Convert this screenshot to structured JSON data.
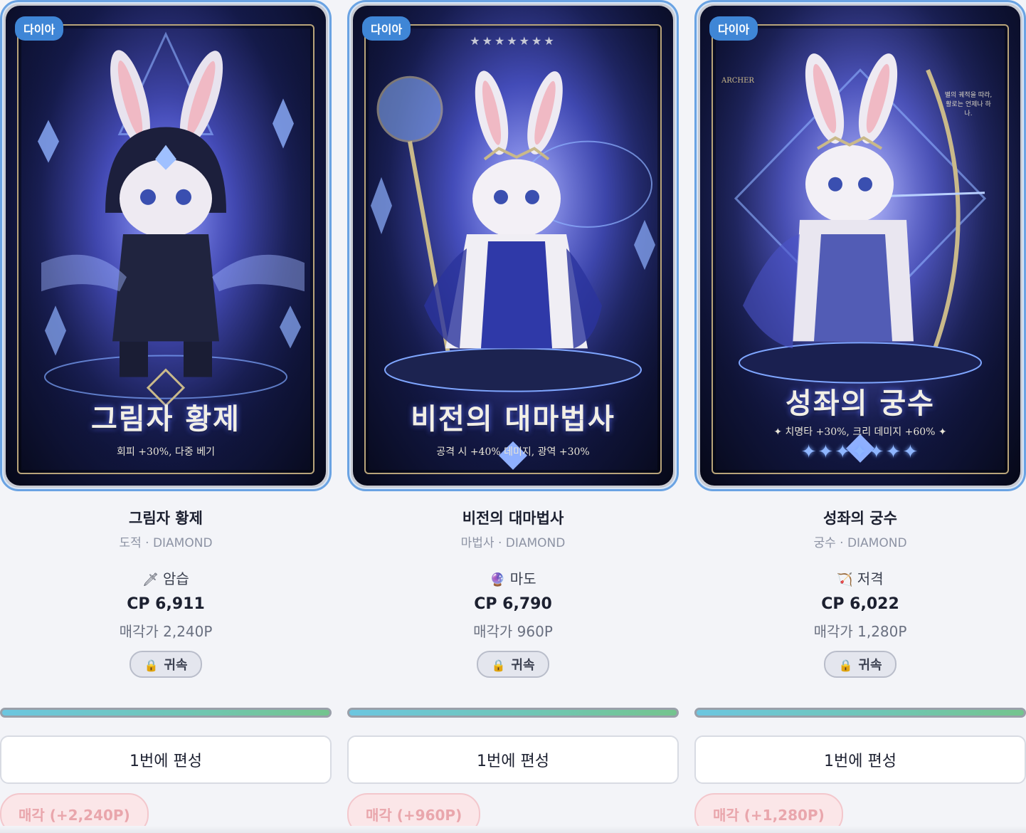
{
  "cards": [
    {
      "tier_badge": "다이아",
      "art_title": "그림자 황제",
      "art_subtitle": "회피 +30%, 다중 베기",
      "name": "그림자 황제",
      "class_line": "도적 · DIAMOND",
      "skill_icon": "dagger-icon",
      "skill_glyph": "🗡",
      "skill": "암습",
      "cp": "CP 6,911",
      "sell_price": "매각가 2,240P",
      "bound_label": "귀속",
      "assign_label": "1번에 편성",
      "sell_label": "매각 (+2,240P)"
    },
    {
      "tier_badge": "다이아",
      "art_title": "비전의 대마법사",
      "art_subtitle": "공격 시 +40% 데미지, 광역 +30%",
      "art_top_stars": "★★★★★★★",
      "name": "비전의 대마법사",
      "class_line": "마법사 · DIAMOND",
      "skill_icon": "crystal-ball-icon",
      "skill_glyph": "🔮",
      "skill": "마도",
      "cp": "CP 6,790",
      "sell_price": "매각가 960P",
      "bound_label": "귀속",
      "assign_label": "1번에 편성",
      "sell_label": "매각 (+960P)"
    },
    {
      "tier_badge": "다이아",
      "art_title": "성좌의 궁수",
      "art_subtitle": "✦ 치명타 +30%, 크리 데미지 +60% ✦",
      "art_stars": "✦✦✦✦✦✦✦",
      "art_mark": "ARCHER",
      "art_quote": "별의 궤적을 따라, 활로는 언제나 하나.",
      "name": "성좌의 궁수",
      "class_line": "궁수 · DIAMOND",
      "skill_icon": "bow-arrow-icon",
      "skill_glyph": "🏹",
      "skill": "저격",
      "cp": "CP 6,022",
      "sell_price": "매각가 1,280P",
      "bound_label": "귀속",
      "assign_label": "1번에 편성",
      "sell_label": "매각 (+1,280P)"
    }
  ],
  "lock_icon": "lock-icon",
  "colors": {
    "badge": "#3f86d6",
    "card_border": "#6aa3e3",
    "sell_text": "#e9a6ac",
    "bar_start": "#6cc6e0",
    "bar_end": "#74c48e"
  }
}
